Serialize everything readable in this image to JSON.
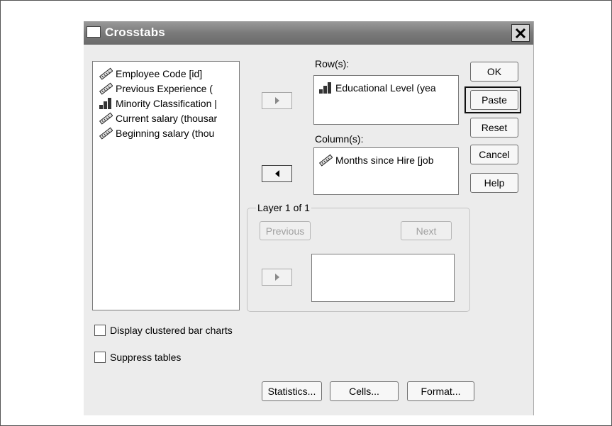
{
  "dialog": {
    "title": "Crosstabs"
  },
  "variables": [
    {
      "label": "Employee Code [id]",
      "icon": "ruler-icon"
    },
    {
      "label": "Previous Experience (",
      "icon": "ruler-icon"
    },
    {
      "label": "Minority Classification |",
      "icon": "bar-chart-icon"
    },
    {
      "label": "Current salary (thousar",
      "icon": "ruler-icon"
    },
    {
      "label": "Beginning salary (thou",
      "icon": "ruler-icon"
    }
  ],
  "rows": {
    "label": "Row(s):",
    "items": [
      {
        "label": "Educational Level (yea",
        "icon": "bar-chart-icon"
      }
    ]
  },
  "columns": {
    "label": "Column(s):",
    "items": [
      {
        "label": "Months since Hire [job",
        "icon": "ruler-icon"
      }
    ]
  },
  "layer": {
    "label": "Layer 1 of 1",
    "previous": "Previous",
    "next": "Next"
  },
  "buttons": {
    "ok": "OK",
    "paste": "Paste",
    "reset": "Reset",
    "cancel": "Cancel",
    "help": "Help"
  },
  "options": {
    "clustered": "Display clustered bar charts",
    "suppress": "Suppress tables"
  },
  "bottom": {
    "statistics": "Statistics...",
    "cells": "Cells...",
    "format": "Format..."
  }
}
